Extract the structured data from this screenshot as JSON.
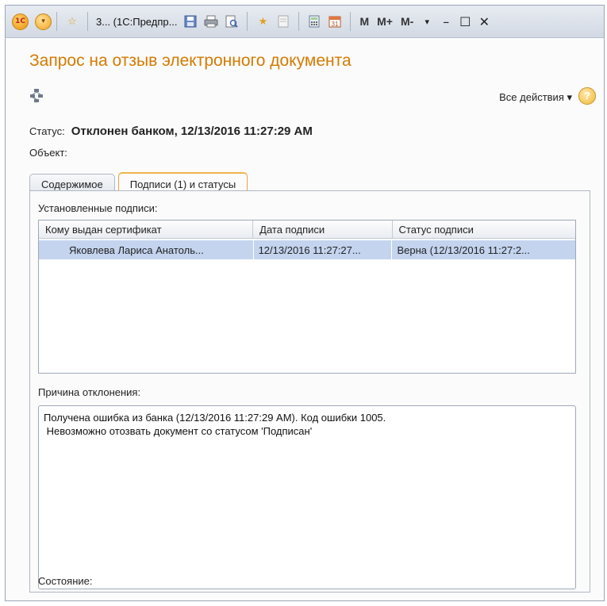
{
  "titlebar": {
    "title": "3... (1С:Предпр...",
    "m_label": "M",
    "mplus_label": "M+",
    "mminus_label": "M-",
    "minimize": "–",
    "maximize": "☐",
    "close": "✕"
  },
  "form": {
    "title": "Запрос на отзыв электронного документа",
    "all_actions_label": "Все действия ▾",
    "help": "?"
  },
  "status": {
    "label": "Статус:",
    "value": "Отклонен банком, 12/13/2016 11:27:29 AM"
  },
  "object": {
    "label": "Объект:"
  },
  "tabs": [
    {
      "label": "Содержимое",
      "active": false
    },
    {
      "label": "Подписи (1) и статусы",
      "active": true
    }
  ],
  "signatures": {
    "label": "Установленные подписи:",
    "columns": [
      "Кому выдан сертификат",
      "Дата подписи",
      "Статус подписи"
    ],
    "rows": [
      [
        "Яковлева Лариса Анатоль...",
        "12/13/2016 11:27:27...",
        "Верна (12/13/2016 11:27:2..."
      ]
    ]
  },
  "rejection": {
    "label": "Причина отклонения:",
    "lines": [
      "Получена ошибка из банка (12/13/2016 11:27:29 AM). Код ошибки 1005.",
      " Невозможно отозвать документ со статусом 'Подписан'"
    ]
  },
  "state": {
    "label": "Состояние:"
  },
  "colors": {
    "title": "#d47a00",
    "selected_row": "#c4d4ef",
    "active_tab_border": "#f0b24a"
  }
}
